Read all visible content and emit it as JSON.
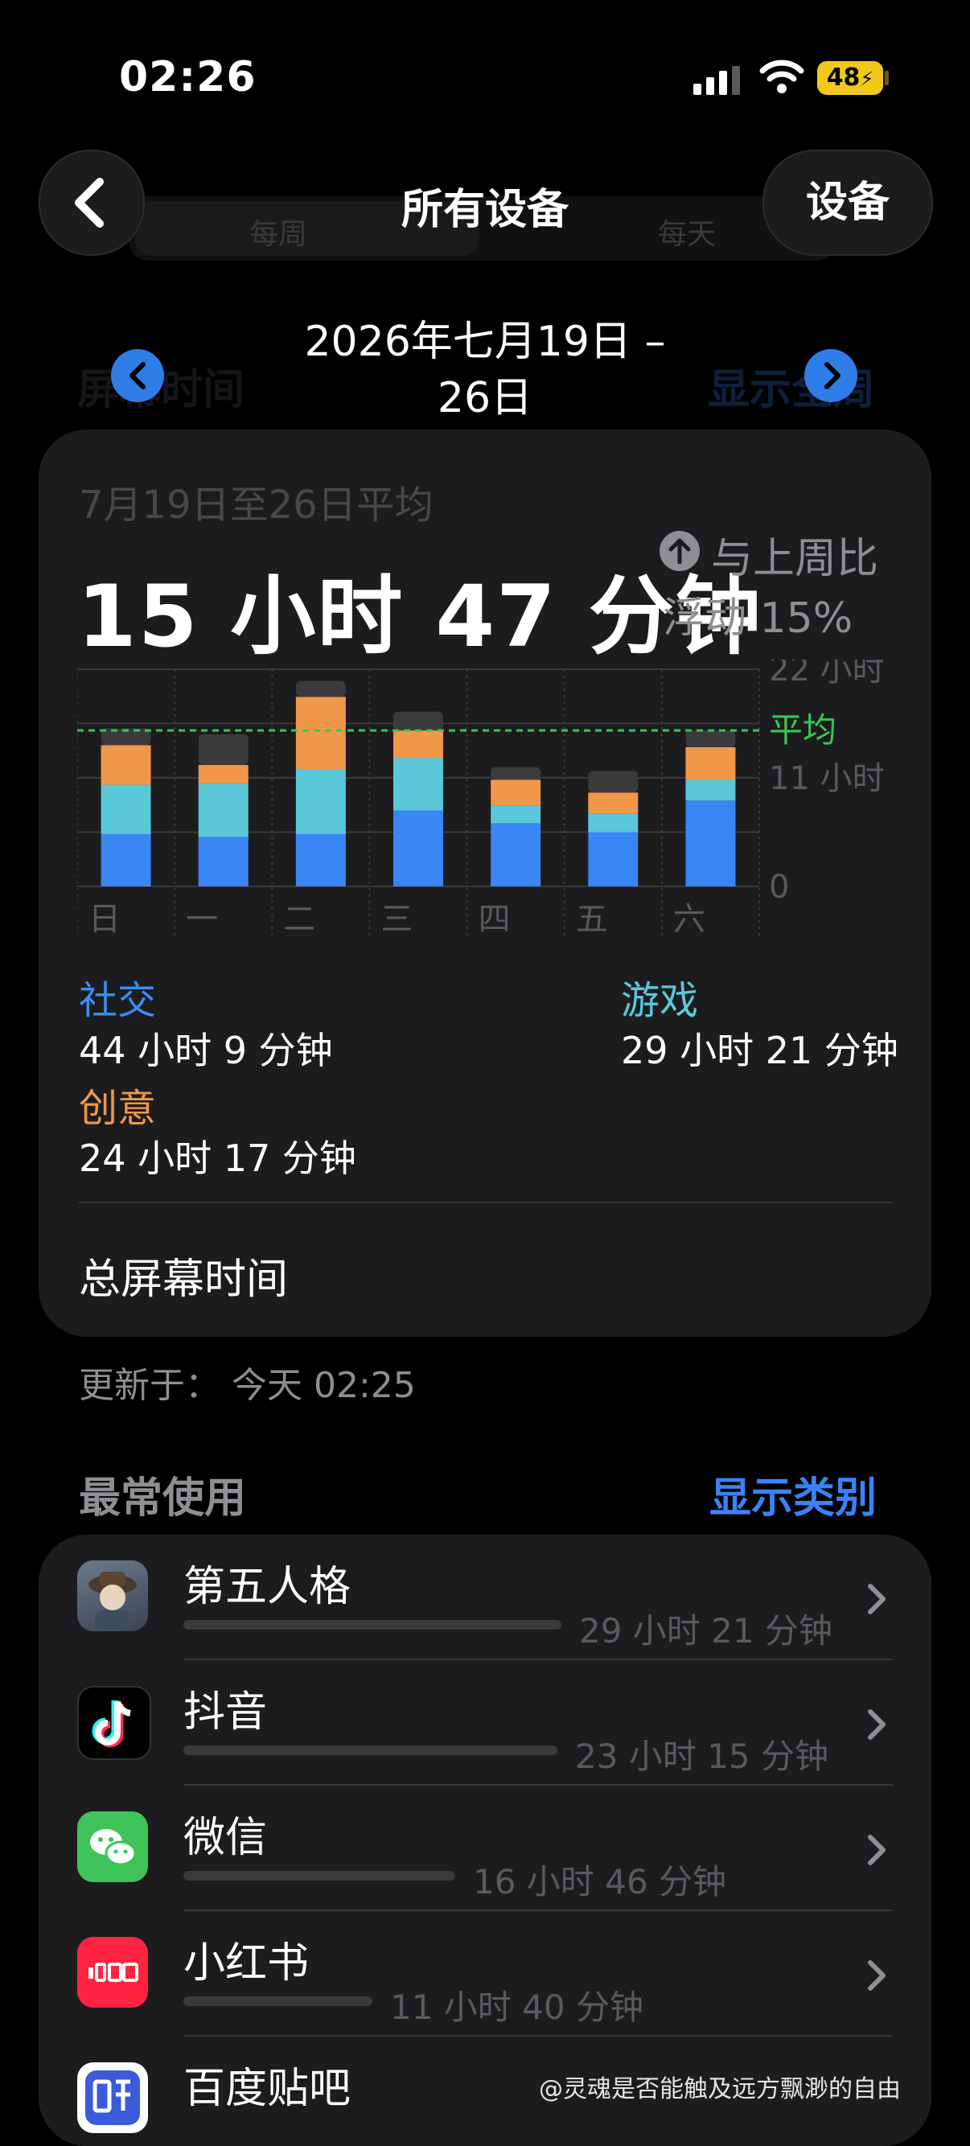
{
  "status_bar": {
    "time": "02:26",
    "battery": "48"
  },
  "nav": {
    "title": "所有设备",
    "device_button": "设备",
    "ghost_tab_week": "每周",
    "ghost_tab_day": "每天"
  },
  "date": {
    "line1": "2026年七月19日 –",
    "line2": "26日",
    "ghost_left": "屏幕时间",
    "ghost_right": "显示全周"
  },
  "summary": {
    "avg_label": "7月19日至26日平均",
    "avg_time": "15 小时 47 分钟",
    "compare_line1": "与上周比",
    "compare_line2": "浮动 15%"
  },
  "chart_data": {
    "type": "bar",
    "stacked": true,
    "categories": [
      "日",
      "一",
      "二",
      "三",
      "四",
      "五",
      "六"
    ],
    "y_ticks": [
      "22 小时",
      "11 小时",
      "0"
    ],
    "ylim": [
      0,
      22
    ],
    "average_label": "平均",
    "average_value": 15.8,
    "series": [
      {
        "name": "社交",
        "color": "#3a86f4",
        "values": [
          5.3,
          5.0,
          5.3,
          7.7,
          6.4,
          5.5,
          8.7
        ]
      },
      {
        "name": "游戏",
        "color": "#5ac8d8",
        "values": [
          5.0,
          5.4,
          6.6,
          5.3,
          1.8,
          1.9,
          2.1
        ]
      },
      {
        "name": "创意",
        "color": "#f0974a",
        "values": [
          4.0,
          1.9,
          7.3,
          2.8,
          2.6,
          2.1,
          3.3
        ]
      },
      {
        "name": "",
        "color": "#3a3a3c",
        "values": [
          1.7,
          3.1,
          1.6,
          1.9,
          1.3,
          2.2,
          1.7
        ]
      }
    ]
  },
  "legend": {
    "social": {
      "name": "社交",
      "value": "44 小时 9 分钟",
      "color": "#3b8cf6"
    },
    "games": {
      "name": "游戏",
      "value": "29 小时 21 分钟",
      "color": "#5ac8d8"
    },
    "creative": {
      "name": "创意",
      "value": "24 小时 17 分钟",
      "color": "#f0974a"
    }
  },
  "total": {
    "label": "总屏幕时间"
  },
  "updated": "更新于：  今天 02:25",
  "most_used": {
    "title": "最常使用",
    "link": "显示类别",
    "apps": [
      {
        "name": "第五人格",
        "time": "29 小时 21 分钟",
        "share": 1.0,
        "icon": "identity-v-icon"
      },
      {
        "name": "抖音",
        "time": "23 小时 15 分钟",
        "share": 0.99,
        "icon": "douyin-icon"
      },
      {
        "name": "微信",
        "time": "16 小时 46 分钟",
        "share": 0.72,
        "icon": "wechat-icon"
      },
      {
        "name": "小红书",
        "time": "11 小时 40 分钟",
        "share": 0.5,
        "icon": "xiaohongshu-icon"
      },
      {
        "name": "百度贴吧",
        "time": "",
        "share": 0,
        "icon": "baidu-tieba-icon"
      }
    ]
  },
  "watermark": "@灵魂是否能触及远方飘渺的自由"
}
